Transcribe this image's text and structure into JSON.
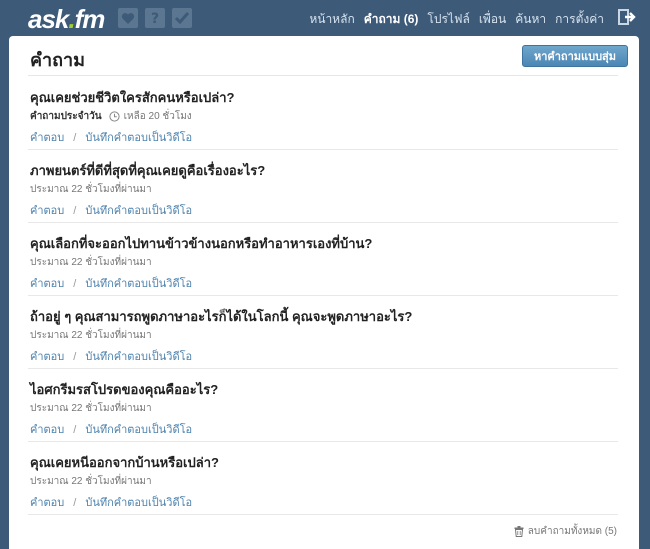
{
  "header": {
    "logo_main": "ask",
    "logo_dot": ".",
    "logo_tail": "fm",
    "icons": [
      "heart-icon",
      "question-icon",
      "check-icon"
    ],
    "nav": [
      "หน้าหลัก",
      "คำถาม (6)",
      "โปรไฟล์",
      "เพื่อน",
      "ค้นหา",
      "การตั้งค่า"
    ],
    "active_nav": "คำถาม (6)"
  },
  "panel": {
    "title": "คำถาม",
    "random_button": "หาคำถามแบบสุ่ม"
  },
  "questions": [
    {
      "title": "คุณเคยช่วยชีวิตใครสักคนหรือเปล่า?",
      "daily_label": "คำถามประจำวัน",
      "time": "เหลือ 20 ชั่วโมง",
      "answer": "คำตอบ",
      "sep": "/",
      "video": "บันทึกคำตอบเป็นวิดีโอ"
    },
    {
      "title": "ภาพยนตร์ที่ดีที่สุดที่คุณเคยดูคือเรื่องอะไร?",
      "time": "ประมาณ 22 ชั่วโมงที่ผ่านมา",
      "answer": "คำตอบ",
      "sep": "/",
      "video": "บันทึกคำตอบเป็นวิดีโอ"
    },
    {
      "title": "คุณเลือกที่จะออกไปทานข้าวข้างนอกหรือทำอาหารเองที่บ้าน?",
      "time": "ประมาณ 22 ชั่วโมงที่ผ่านมา",
      "answer": "คำตอบ",
      "sep": "/",
      "video": "บันทึกคำตอบเป็นวิดีโอ"
    },
    {
      "title": "ถ้าอยู่ ๆ คุณสามารถพูดภาษาอะไรก็ได้ในโลกนี้ คุณจะพูดภาษาอะไร?",
      "time": "ประมาณ 22 ชั่วโมงที่ผ่านมา",
      "answer": "คำตอบ",
      "sep": "/",
      "video": "บันทึกคำตอบเป็นวิดีโอ"
    },
    {
      "title": "ไอศกรีมรสโปรดของคุณคืออะไร?",
      "time": "ประมาณ 22 ชั่วโมงที่ผ่านมา",
      "answer": "คำตอบ",
      "sep": "/",
      "video": "บันทึกคำตอบเป็นวิดีโอ"
    },
    {
      "title": "คุณเคยหนีออกจากบ้านหรือเปล่า?",
      "time": "ประมาณ 22 ชั่วโมงที่ผ่านมา",
      "answer": "คำตอบ",
      "sep": "/",
      "video": "บันทึกคำตอบเป็นวิดีโอ"
    }
  ],
  "footer": {
    "delete_all": "ลบคำถามทั้งหมด (5)"
  },
  "colors": {
    "header_bg": "#3d5a78",
    "link": "#4d82ad",
    "button": "#5a94c0",
    "logo_accent": "#9fd02e"
  }
}
